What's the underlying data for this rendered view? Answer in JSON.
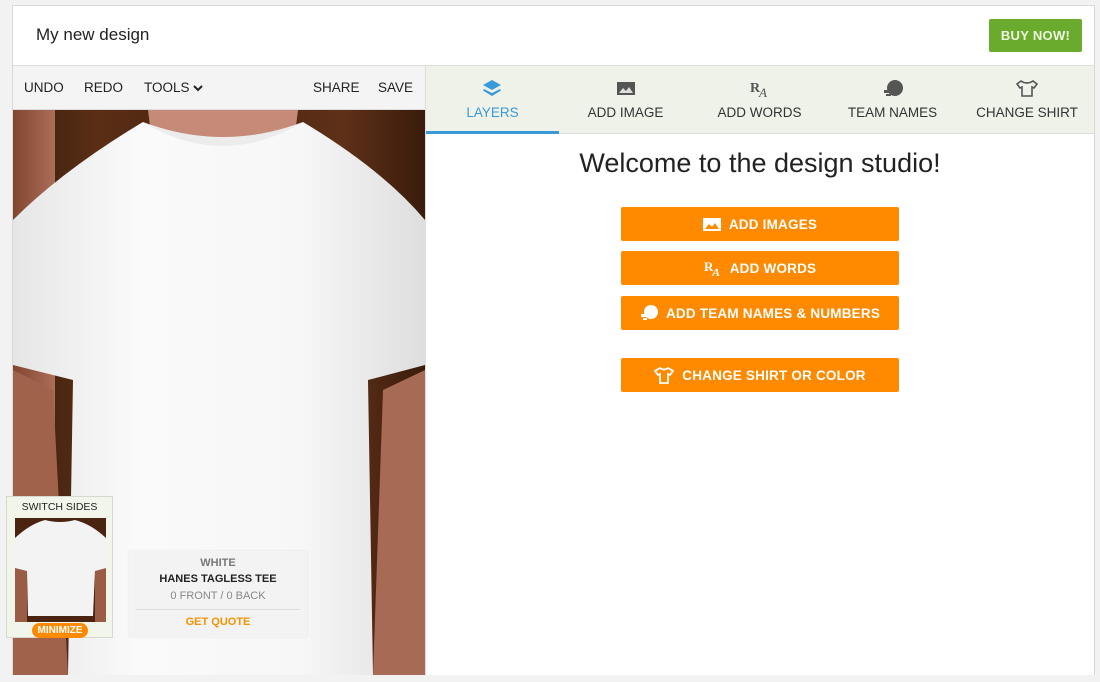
{
  "header": {
    "title": "My new design",
    "buy_label": "BUY NOW!"
  },
  "toolbar": {
    "undo": "UNDO",
    "redo": "REDO",
    "tools": "TOOLS",
    "share": "SHARE",
    "save": "SAVE"
  },
  "tabs": [
    {
      "label": "LAYERS",
      "icon": "layers-icon",
      "active": true
    },
    {
      "label": "ADD IMAGE",
      "icon": "image-icon"
    },
    {
      "label": "ADD WORDS",
      "icon": "text-icon"
    },
    {
      "label": "TEAM NAMES",
      "icon": "helmet-icon"
    },
    {
      "label": "CHANGE SHIRT",
      "icon": "shirt-icon"
    }
  ],
  "panel": {
    "welcome": "Welcome to the design studio!",
    "buttons": [
      {
        "label": "ADD IMAGES",
        "icon": "image-icon"
      },
      {
        "label": "ADD WORDS",
        "icon": "text-icon"
      },
      {
        "label": "ADD TEAM NAMES & NUMBERS",
        "icon": "helmet-icon"
      },
      {
        "label": "CHANGE SHIRT OR COLOR",
        "icon": "shirt-icon"
      }
    ]
  },
  "preview": {
    "switch_label": "SWITCH SIDES",
    "minimize_label": "MINIMIZE",
    "color": "WHITE",
    "product": "HANES TAGLESS TEE",
    "summary": "0 FRONT / 0 BACK",
    "quote_label": "GET QUOTE"
  },
  "colors": {
    "accent": "#3a9ad9",
    "orange": "#ff8a00",
    "buy": "#6aab2e"
  }
}
